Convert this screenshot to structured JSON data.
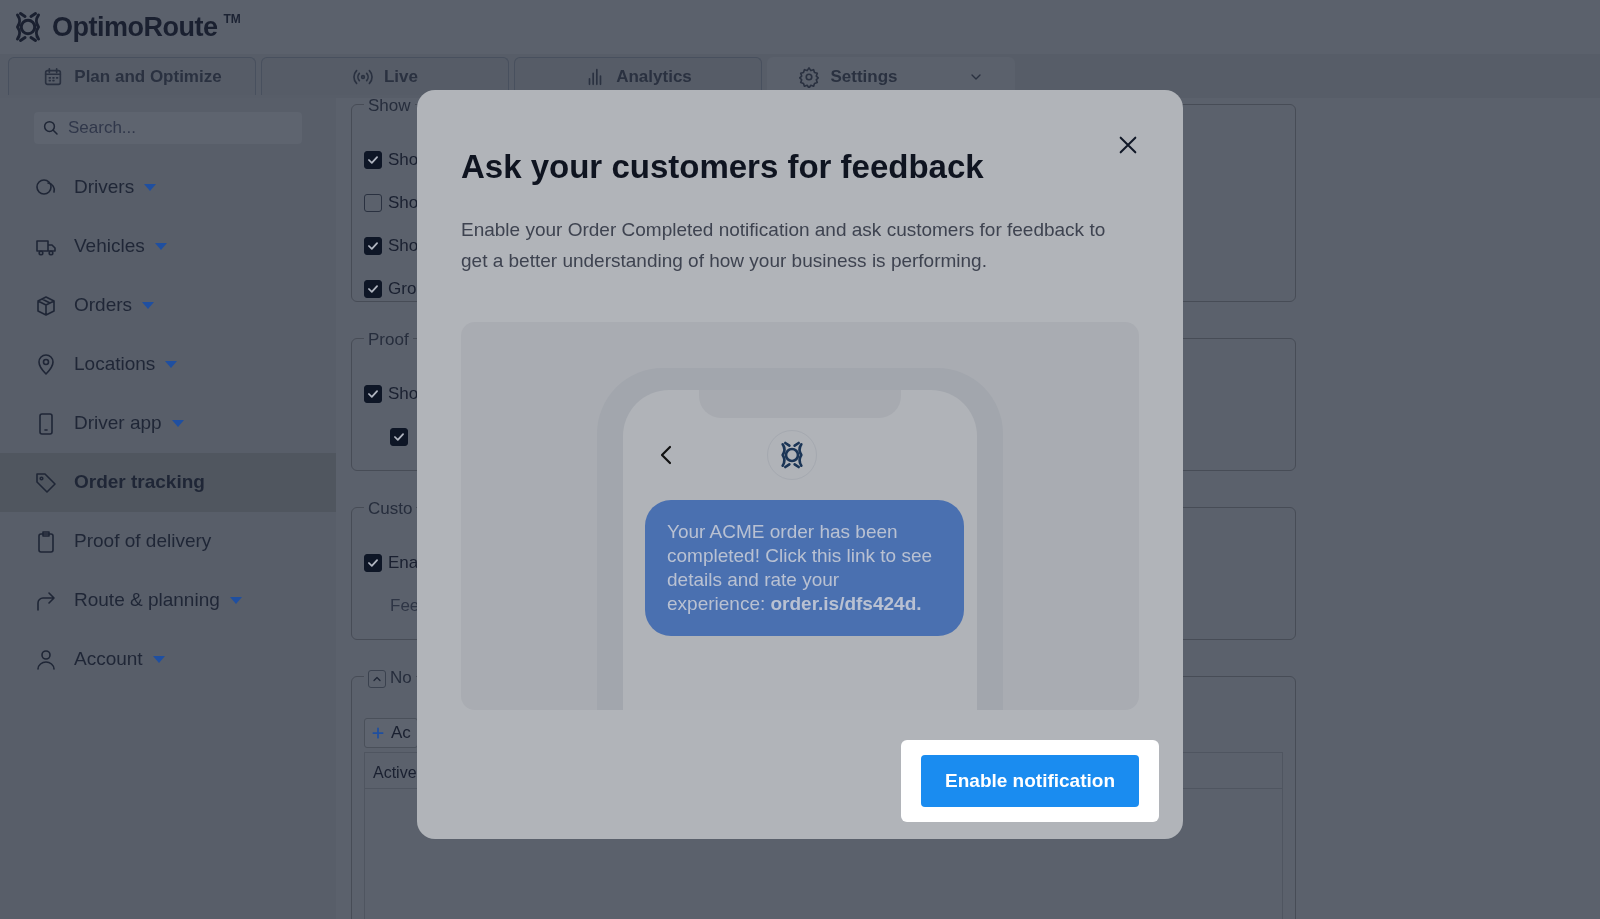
{
  "app": {
    "logo": "OptimoRoute",
    "trademark": "TM"
  },
  "tabs": [
    {
      "label": "Plan and Optimize",
      "selected": false
    },
    {
      "label": "Live",
      "selected": false
    },
    {
      "label": "Analytics",
      "selected": false
    },
    {
      "label": "Settings",
      "selected": true
    }
  ],
  "sidebar": {
    "search": {
      "placeholder": "Search..."
    },
    "items": [
      {
        "label": "Drivers",
        "dropdown": true,
        "selected": false
      },
      {
        "label": "Vehicles",
        "dropdown": true,
        "selected": false
      },
      {
        "label": "Orders",
        "dropdown": true,
        "selected": false
      },
      {
        "label": "Locations",
        "dropdown": true,
        "selected": false
      },
      {
        "label": "Driver app",
        "dropdown": true,
        "selected": false
      },
      {
        "label": "Order tracking",
        "dropdown": false,
        "selected": true
      },
      {
        "label": "Proof of delivery",
        "dropdown": false,
        "selected": false
      },
      {
        "label": "Route & planning",
        "dropdown": true,
        "selected": false
      },
      {
        "label": "Account",
        "dropdown": true,
        "selected": false
      }
    ]
  },
  "sections": [
    {
      "legend": "Show",
      "rows": [
        {
          "kind": "checkbox",
          "label": "Sho",
          "checked": true
        },
        {
          "kind": "checkbox",
          "label": "Sho",
          "checked": false
        },
        {
          "kind": "checkbox",
          "label": "Sho",
          "checked": true
        },
        {
          "kind": "checkbox",
          "label": "Gro",
          "checked": true
        }
      ]
    },
    {
      "legend": "Proof",
      "rows": [
        {
          "kind": "checkbox",
          "label": "Sho",
          "checked": true
        },
        {
          "kind": "subcheckbox",
          "checked": true
        }
      ]
    },
    {
      "legend": "Custo",
      "rows": [
        {
          "kind": "checkbox",
          "label": "Ena",
          "checked": true
        },
        {
          "kind": "note",
          "label": "Fee"
        }
      ]
    },
    {
      "legend": "No",
      "collapsible": true,
      "add_button": "Ac",
      "table_header": "Active"
    }
  ],
  "modal": {
    "title": "Ask your customers for feedback",
    "description": "Enable your Order Completed notification and ask customers for feedback to get a better understanding of how your business is performing.",
    "message": "Your ACME order has been completed! Click this link to see details and rate your experience: **order.is/dfs424d.**",
    "button": "Enable notification"
  }
}
